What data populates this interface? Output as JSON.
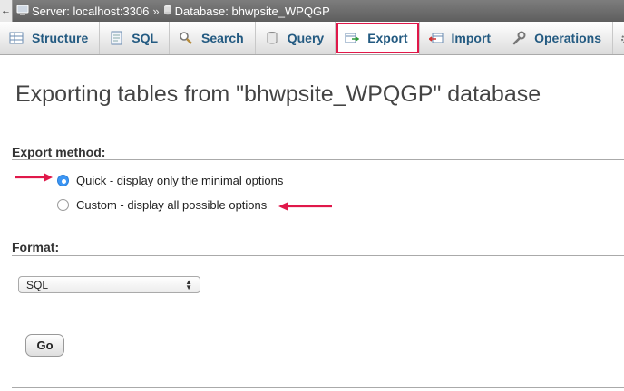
{
  "breadcrumb": {
    "server_label": "Server: localhost:3306",
    "separator": "»",
    "database_label": "Database: bhwpsite_WPQGP"
  },
  "tabs": [
    {
      "label": "Structure",
      "icon": "structure-icon"
    },
    {
      "label": "SQL",
      "icon": "sql-icon"
    },
    {
      "label": "Search",
      "icon": "search-icon"
    },
    {
      "label": "Query",
      "icon": "query-icon"
    },
    {
      "label": "Export",
      "icon": "export-icon",
      "active": true
    },
    {
      "label": "Import",
      "icon": "import-icon"
    },
    {
      "label": "Operations",
      "icon": "wrench-icon"
    }
  ],
  "page_title": "Exporting tables from \"bhwpsite_WPQGP\" database",
  "export_method": {
    "heading": "Export method:",
    "options": [
      {
        "label": "Quick - display only the minimal options",
        "checked": true
      },
      {
        "label": "Custom - display all possible options",
        "checked": false
      }
    ]
  },
  "format": {
    "heading": "Format:",
    "selected": "SQL"
  },
  "go_label": "Go",
  "colors": {
    "accent_tab_text": "#235a81",
    "highlight": "#e0184a",
    "radio_checked": "#3b95f4"
  }
}
